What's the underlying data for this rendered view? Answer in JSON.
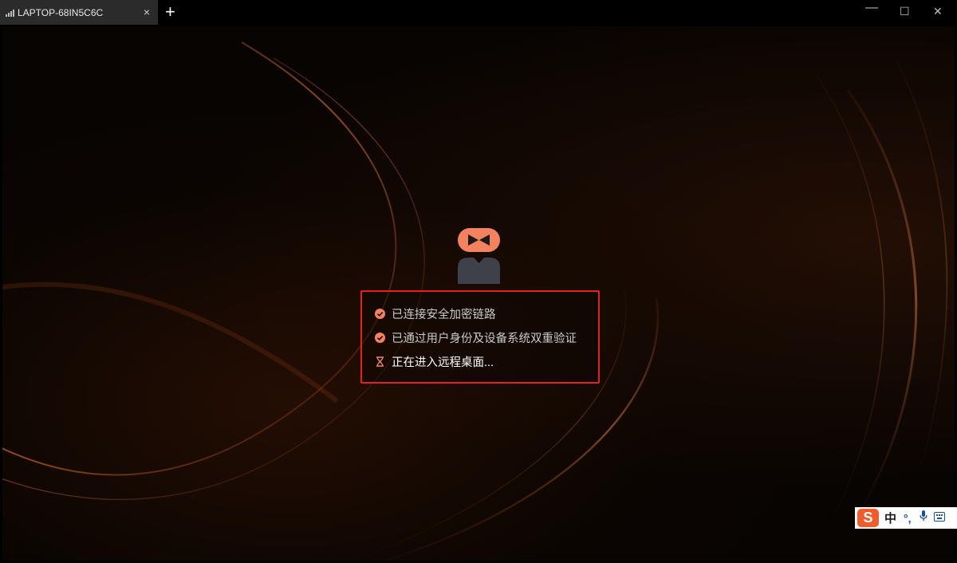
{
  "tab": {
    "title": "LAPTOP-68IN5C6C",
    "close_glyph": "×",
    "signal_icon": "signal-bars-icon"
  },
  "toolbar": {
    "new_tab_glyph": "+"
  },
  "window_controls": {
    "minimize_glyph": "—",
    "maximize_glyph": "☐",
    "close_glyph": "✕"
  },
  "status": {
    "items": [
      {
        "text": "已连接安全加密链路",
        "state": "done",
        "icon": "check-circle-icon"
      },
      {
        "text": "已通过用户身份及设备系统双重验证",
        "state": "done",
        "icon": "check-circle-icon"
      },
      {
        "text": "正在进入远程桌面...",
        "state": "in-progress",
        "icon": "hourglass-icon"
      }
    ]
  },
  "ime": {
    "logo": "S",
    "language": "中",
    "punctuation": "°,"
  },
  "colors": {
    "accent": "#f4825f",
    "highlight_border": "#e3221b",
    "avatar_body": "#3f414a"
  }
}
